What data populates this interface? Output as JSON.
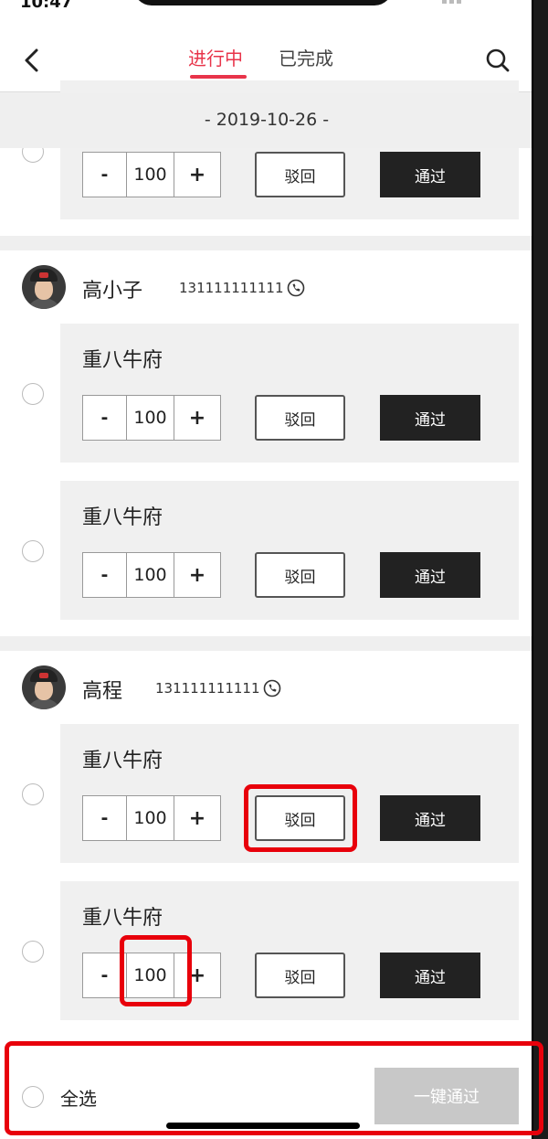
{
  "status_bar": {
    "time": "10:47"
  },
  "header": {
    "tabs": [
      {
        "label": "进行中",
        "active": true
      },
      {
        "label": "已完成",
        "active": false
      }
    ],
    "icons": {
      "back": "chevron-left-icon",
      "search": "search-icon"
    }
  },
  "date": "- 2019-10-26 -",
  "partial_card": {
    "qty": "100",
    "reject_label": "驳回",
    "pass_label": "通过"
  },
  "groups": [
    {
      "name": "高小子",
      "phone": "131111111111",
      "items": [
        {
          "title": "重八牛府",
          "qty": "100",
          "minus": "-",
          "plus": "+",
          "reject_label": "驳回",
          "pass_label": "通过"
        },
        {
          "title": "重八牛府",
          "qty": "100",
          "minus": "-",
          "plus": "+",
          "reject_label": "驳回",
          "pass_label": "通过"
        }
      ]
    },
    {
      "name": "高程",
      "phone": "131111111111",
      "items": [
        {
          "title": "重八牛府",
          "qty": "100",
          "minus": "-",
          "plus": "+",
          "reject_label": "驳回",
          "pass_label": "通过"
        },
        {
          "title": "重八牛府",
          "qty": "100",
          "minus": "-",
          "plus": "+",
          "reject_label": "驳回",
          "pass_label": "通过"
        }
      ]
    }
  ],
  "bottom_bar": {
    "select_all_label": "全选",
    "one_key_pass_label": "一键通过"
  },
  "colors": {
    "accent": "#e8344a",
    "pass_button": "#222222",
    "disabled_button": "#c8c8c8",
    "highlight": "#e8000b"
  }
}
